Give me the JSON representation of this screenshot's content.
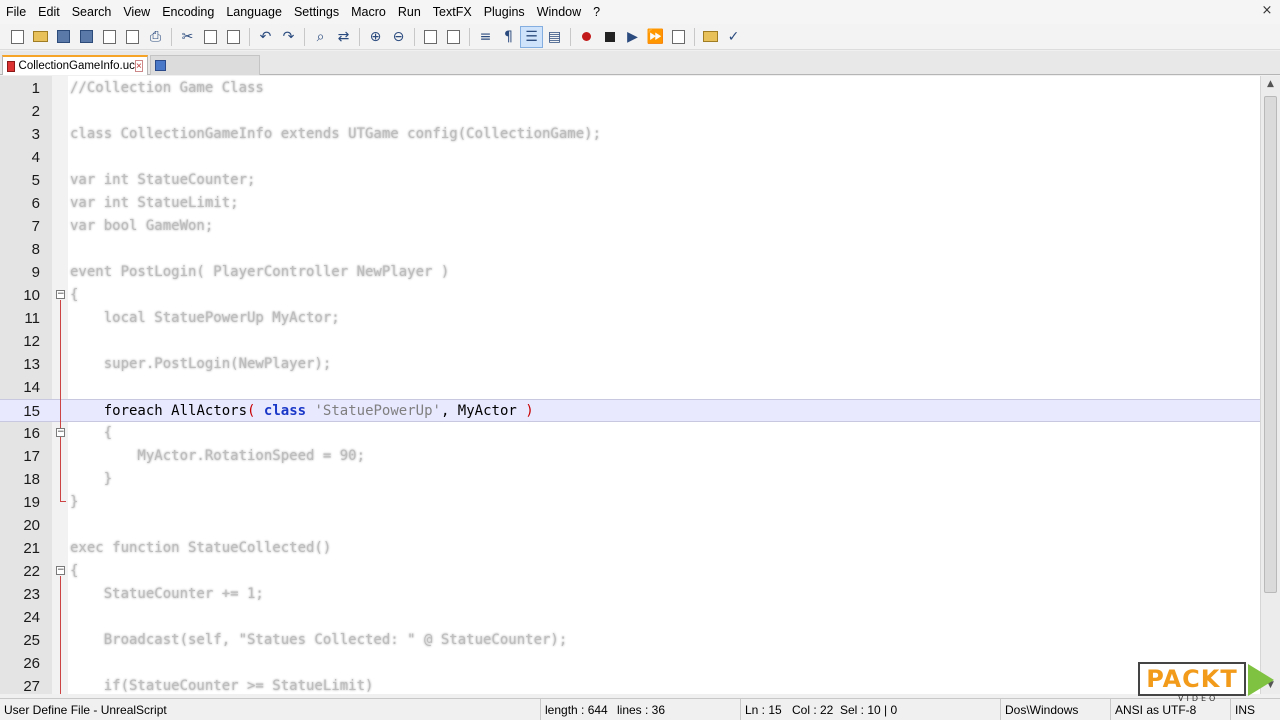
{
  "menu": [
    "File",
    "Edit",
    "Search",
    "View",
    "Encoding",
    "Language",
    "Settings",
    "Macro",
    "Run",
    "TextFX",
    "Plugins",
    "Window",
    "?"
  ],
  "window_close": "×",
  "tabs": {
    "active": "CollectionGameInfo.uc",
    "close": "×"
  },
  "editor": {
    "current_line": 15,
    "lines": [
      {
        "n": "1",
        "text": "//Collection Game Class"
      },
      {
        "n": "2",
        "text": ""
      },
      {
        "n": "3",
        "text": "class CollectionGameInfo extends UTGame config(CollectionGame);"
      },
      {
        "n": "4",
        "text": ""
      },
      {
        "n": "5",
        "text": "var int StatueCounter;"
      },
      {
        "n": "6",
        "text": "var int StatueLimit;"
      },
      {
        "n": "7",
        "text": "var bool GameWon;"
      },
      {
        "n": "8",
        "text": ""
      },
      {
        "n": "9",
        "text": "event PostLogin( PlayerController NewPlayer )"
      },
      {
        "n": "10",
        "text": "{"
      },
      {
        "n": "11",
        "text": "    local StatuePowerUp MyActor;"
      },
      {
        "n": "12",
        "text": ""
      },
      {
        "n": "13",
        "text": "    super.PostLogin(NewPlayer);"
      },
      {
        "n": "14",
        "text": ""
      },
      {
        "n": "15",
        "text": "    foreach AllActors( class 'StatuePowerUp', MyActor )"
      },
      {
        "n": "16",
        "text": "    {"
      },
      {
        "n": "17",
        "text": "        MyActor.RotationSpeed = 90;"
      },
      {
        "n": "18",
        "text": "    }"
      },
      {
        "n": "19",
        "text": "}"
      },
      {
        "n": "20",
        "text": ""
      },
      {
        "n": "21",
        "text": "exec function StatueCollected()"
      },
      {
        "n": "22",
        "text": "{"
      },
      {
        "n": "23",
        "text": "    StatueCounter += 1;"
      },
      {
        "n": "24",
        "text": ""
      },
      {
        "n": "25",
        "text": "    Broadcast(self, \"Statues Collected: \" @ StatueCounter);"
      },
      {
        "n": "26",
        "text": ""
      },
      {
        "n": "27",
        "text": "    if(StatueCounter >= StatueLimit)"
      }
    ],
    "current": {
      "kw1": "foreach",
      "fn": "AllActors",
      "open": "(",
      "kw2": "class",
      "str": "'StatuePowerUp'",
      "rest": ", MyActor",
      "close": ")"
    }
  },
  "status": {
    "language": "User Define File - UnrealScript",
    "length": "length : 644",
    "lines": "lines : 36",
    "ln": "Ln : 15",
    "col": "Col : 22",
    "sel": "Sel : 10 | 0",
    "eol": "Dos\\Windows",
    "encoding": "ANSI as UTF-8",
    "mode": "INS"
  },
  "watermark": {
    "brand": "PACKT",
    "sub": "VIDEO"
  },
  "colors": {
    "keyword": "#1a38c8",
    "current_line_bg": "#e8e8ff",
    "tab_accent": "#f6a428",
    "brand_orange": "#f29a1a",
    "brand_green": "#7fc241"
  }
}
